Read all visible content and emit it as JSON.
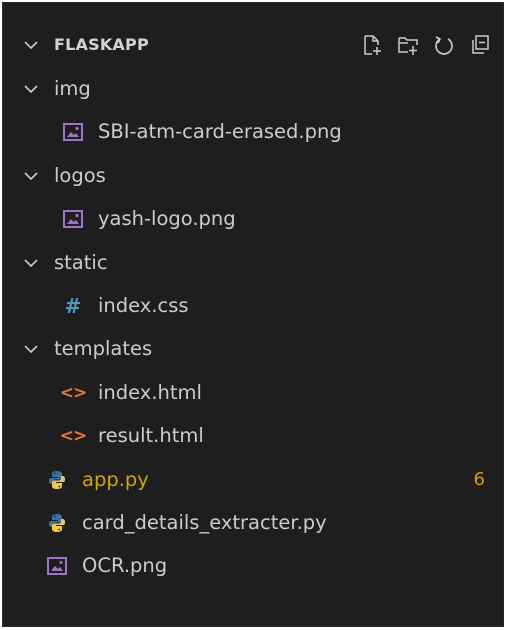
{
  "explorer": {
    "title": "FLASKAPP",
    "actions": [
      {
        "name": "new-file-icon"
      },
      {
        "name": "new-folder-icon"
      },
      {
        "name": "refresh-icon"
      },
      {
        "name": "collapse-all-icon"
      }
    ]
  },
  "tree": [
    {
      "type": "folder",
      "label": "img"
    },
    {
      "type": "image",
      "label": "SBI-atm-card-erased.png"
    },
    {
      "type": "folder",
      "label": "logos"
    },
    {
      "type": "image",
      "label": "yash-logo.png"
    },
    {
      "type": "folder",
      "label": "static"
    },
    {
      "type": "css",
      "icon": "#",
      "label": "index.css"
    },
    {
      "type": "folder",
      "label": "templates"
    },
    {
      "type": "html",
      "icon": "<>",
      "label": "index.html"
    },
    {
      "type": "html",
      "icon": "<>",
      "label": "result.html"
    },
    {
      "type": "python",
      "label": "app.py",
      "badge": "6"
    },
    {
      "type": "python",
      "label": "card_details_extracter.py"
    },
    {
      "type": "image",
      "label": "OCR.png"
    }
  ],
  "colors": {
    "background": "#1e1e1e",
    "text": "#cccccc",
    "warning": "#cca700",
    "html_icon": "#e37933",
    "css_icon": "#519aba",
    "image_icon": "#a074c4",
    "python_blue": "#3572a5",
    "python_yellow": "#f3c94c"
  }
}
